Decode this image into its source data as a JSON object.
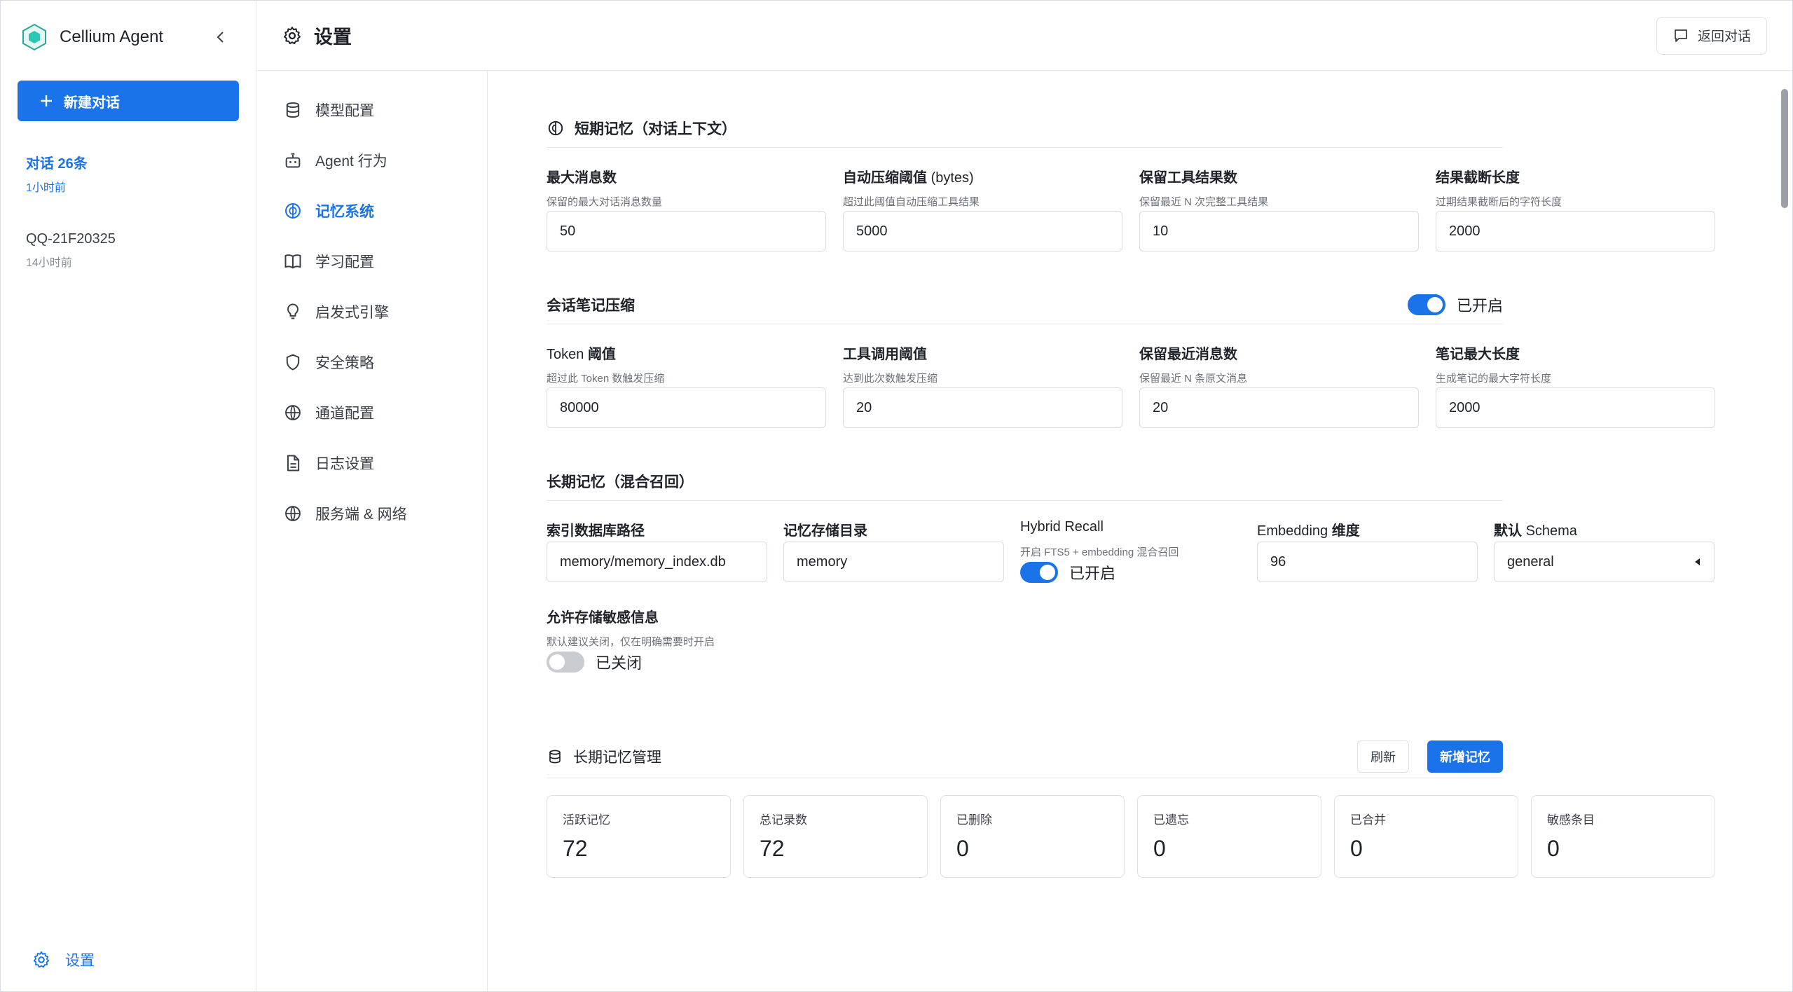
{
  "brand": {
    "name": "Cellium Agent"
  },
  "sidebar": {
    "new_chat_label": "新建对话",
    "conversations": [
      {
        "title": "对话 26条",
        "time": "1小时前"
      },
      {
        "title": "QQ-21F20325",
        "time": "14小时前"
      }
    ],
    "footer_label": "设置"
  },
  "header": {
    "title": "设置",
    "back_label": "返回对话"
  },
  "nav": {
    "items": [
      {
        "label": "模型配置",
        "icon": "database-icon"
      },
      {
        "label": "Agent 行为",
        "icon": "robot-icon"
      },
      {
        "label": "记忆系统",
        "icon": "brain-icon"
      },
      {
        "label": "学习配置",
        "icon": "book-icon"
      },
      {
        "label": "启发式引擎",
        "icon": "bulb-icon"
      },
      {
        "label": "安全策略",
        "icon": "shield-icon"
      },
      {
        "label": "通道配置",
        "icon": "globe-icon"
      },
      {
        "label": "日志设置",
        "icon": "file-icon"
      },
      {
        "label": "服务端 & 网络",
        "icon": "globe-icon"
      }
    ],
    "active_index": 2
  },
  "short_term": {
    "title": "短期记忆（对话上下文）",
    "fields": [
      {
        "label": "最大消息数",
        "hint": "保留的最大对话消息数量",
        "value": "50"
      },
      {
        "label": "自动压缩阈值",
        "label_suffix": "(bytes)",
        "hint": "超过此阈值自动压缩工具结果",
        "value": "5000"
      },
      {
        "label": "保留工具结果数",
        "hint": "保留最近 N 次完整工具结果",
        "value": "10"
      },
      {
        "label": "结果截断长度",
        "hint": "过期结果截断后的字符长度",
        "value": "2000"
      }
    ]
  },
  "session_notes": {
    "title": "会话笔记压缩",
    "toggle_label": "已开启",
    "fields": [
      {
        "label_prefix": "Token",
        "label": "阈值",
        "hint": "超过此 Token 数触发压缩",
        "value": "80000"
      },
      {
        "label": "工具调用阈值",
        "hint": "达到此次数触发压缩",
        "value": "20"
      },
      {
        "label": "保留最近消息数",
        "hint": "保留最近 N 条原文消息",
        "value": "20"
      },
      {
        "label": "笔记最大长度",
        "hint": "生成笔记的最大字符长度",
        "value": "2000"
      }
    ]
  },
  "long_term": {
    "title": "长期记忆（混合召回）",
    "index_db_label": "索引数据库路径",
    "index_db_value": "memory/memory_index.db",
    "storage_dir_label": "记忆存储目录",
    "storage_dir_value": "memory",
    "hybrid_label": "Hybrid Recall",
    "hybrid_hint": "开启 FTS5 + embedding 混合召回",
    "hybrid_toggle_label": "已开启",
    "embedding_label_prefix": "Embedding",
    "embedding_label": "维度",
    "embedding_value": "96",
    "schema_label": "默认",
    "schema_label_suffix": "Schema",
    "schema_value": "general",
    "sensitive_label": "允许存储敏感信息",
    "sensitive_hint": "默认建议关闭，仅在明确需要时开启",
    "sensitive_toggle_label": "已关闭"
  },
  "management": {
    "title": "长期记忆管理",
    "refresh_label": "刷新",
    "add_label": "新增记忆",
    "stats": [
      {
        "label": "活跃记忆",
        "value": "72"
      },
      {
        "label": "总记录数",
        "value": "72"
      },
      {
        "label": "已删除",
        "value": "0"
      },
      {
        "label": "已遗忘",
        "value": "0"
      },
      {
        "label": "已合并",
        "value": "0"
      },
      {
        "label": "敏感条目",
        "value": "0"
      }
    ]
  },
  "colors": {
    "accent": "#1a73e8",
    "border": "#d9dde3",
    "text": "#1f2329"
  }
}
